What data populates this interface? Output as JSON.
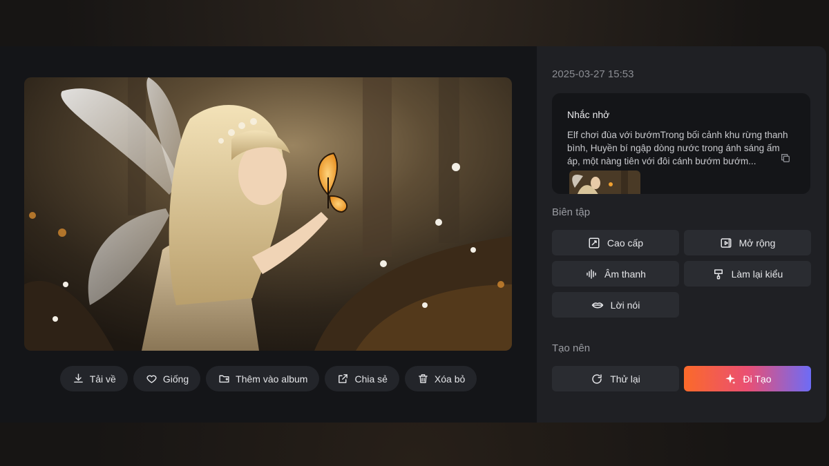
{
  "timestamp": "2025-03-27 15:53",
  "prompt": {
    "title": "Nhắc nhở",
    "text": "Elf chơi đùa với bướmTrong bối cảnh khu rừng thanh bình, Huyền bí ngập dòng nước trong ánh sáng ấm áp, một nàng tiên với đôi cánh bướm bướm..."
  },
  "actions": {
    "download": "Tải về",
    "like": "Giống",
    "add_album": "Thêm vào album",
    "share": "Chia sẻ",
    "delete": "Xóa bỏ"
  },
  "edit": {
    "label": "Biên tập",
    "advanced": "Cao cấp",
    "expand": "Mở rộng",
    "audio": "Âm thanh",
    "restyle": "Làm lại kiểu",
    "speech": "Lời nói"
  },
  "create": {
    "label": "Tạo nên",
    "retry": "Thử lại",
    "generate": "Đi Tạo"
  },
  "colors": {
    "accent_start": "#fb6a2a",
    "accent_mid": "#ea4f73",
    "accent_end": "#6d6cf6"
  }
}
